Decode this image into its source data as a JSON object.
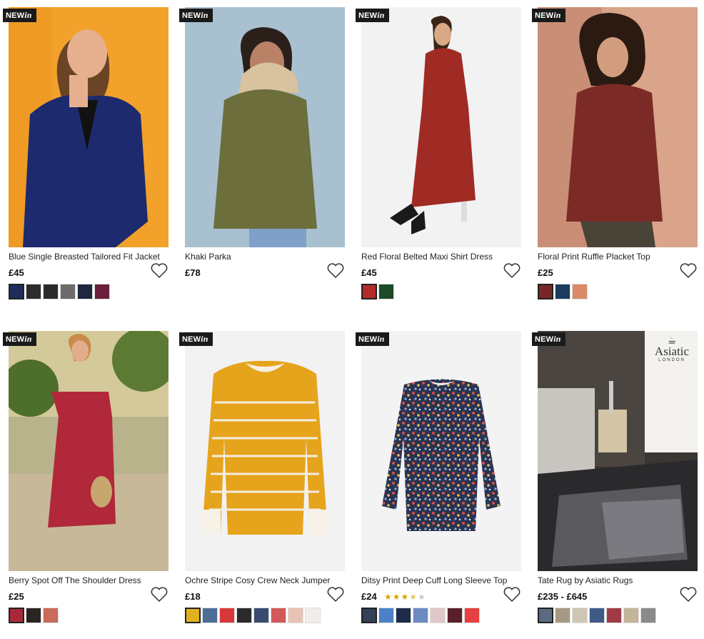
{
  "badge": {
    "new": "NEW",
    "in": "in"
  },
  "products": [
    {
      "title": "Blue Single Breasted Tailored Fit Jacket",
      "price": "£45",
      "new_in": true,
      "image": "woman-blue-blazer",
      "swatches": [
        "#1f2c5c",
        "#2c2c2c",
        "#2a2a2a",
        "#6e6b6a",
        "#1f2640",
        "#6a1f3c"
      ]
    },
    {
      "title": "Khaki Parka",
      "price": "£78",
      "new_in": true,
      "image": "woman-khaki-parka",
      "swatches": []
    },
    {
      "title": "Red Floral Belted Maxi Shirt Dress",
      "price": "£45",
      "new_in": true,
      "image": "woman-red-floral-dress",
      "swatches": [
        "#b32a2a",
        "#1d4a2a"
      ]
    },
    {
      "title": "Floral Print Ruffle Placket Top",
      "price": "£25",
      "new_in": true,
      "image": "woman-floral-top",
      "swatches": [
        "#7a2626",
        "#1e3a5c",
        "#d98a66"
      ]
    },
    {
      "title": "Berry Spot Off The Shoulder Dress",
      "price": "£25",
      "new_in": true,
      "image": "woman-berry-dress",
      "swatches": [
        "#a8283a",
        "#2a2522",
        "#c96a5a"
      ]
    },
    {
      "title": "Ochre Stripe Cosy Crew Neck Jumper",
      "price": "£18",
      "new_in": true,
      "image": "ochre-stripe-jumper",
      "swatches": [
        "#e0b020",
        "#4c6e96",
        "#d8383a",
        "#2a2a2a",
        "#3a4a70",
        "#d25a5a",
        "#e8c3b3",
        "#f1eeea"
      ]
    },
    {
      "title": "Ditsy Print Deep Cuff Long Sleeve Top",
      "price": "£24",
      "new_in": true,
      "image": "ditsy-print-top",
      "rating": 3.5,
      "swatches": [
        "#344058",
        "#4d80c8",
        "#1d2a4a",
        "#6d8ac0",
        "#e0c8c8",
        "#5a1f2a",
        "#e64040"
      ]
    },
    {
      "title": "Tate Rug by Asiatic Rugs",
      "price": "£235 - £645",
      "new_in": true,
      "image": "grey-rug-bedroom",
      "brand_logo": "Asiatic",
      "brand_sub": "LONDON",
      "swatches": [
        "#5a6a80",
        "#a69a84",
        "#d0c4b4",
        "#3e5a86",
        "#a03a44",
        "#c4b49a",
        "#8a8a8a"
      ]
    }
  ],
  "rating_stars": {
    "on": "★",
    "off": "★"
  }
}
